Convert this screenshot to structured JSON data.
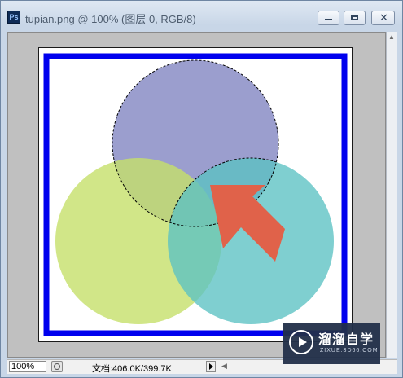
{
  "window": {
    "title": "tupian.png @ 100% (图层 0, RGB/8)",
    "app_icon_label": "Ps",
    "icons": {
      "minimize": "minimize-icon",
      "maximize": "maximize-icon",
      "close": "close-icon",
      "close_glyph": "✕"
    }
  },
  "canvas": {
    "border_color": "#0000ee",
    "circles": [
      {
        "name": "purple",
        "color": "#8a8dc6"
      },
      {
        "name": "yellow-green",
        "color": "#c5e06a"
      },
      {
        "name": "teal",
        "color": "#5bc2c3"
      }
    ],
    "arrow_color": "#e0624a",
    "selection": "marching-ants selection around top circle"
  },
  "statusbar": {
    "zoom": "100%",
    "doc_size": "文档:406.0K/399.7K"
  },
  "watermark": {
    "title": "溜溜自学",
    "subtitle": "ZIXUE.3D66.COM"
  }
}
